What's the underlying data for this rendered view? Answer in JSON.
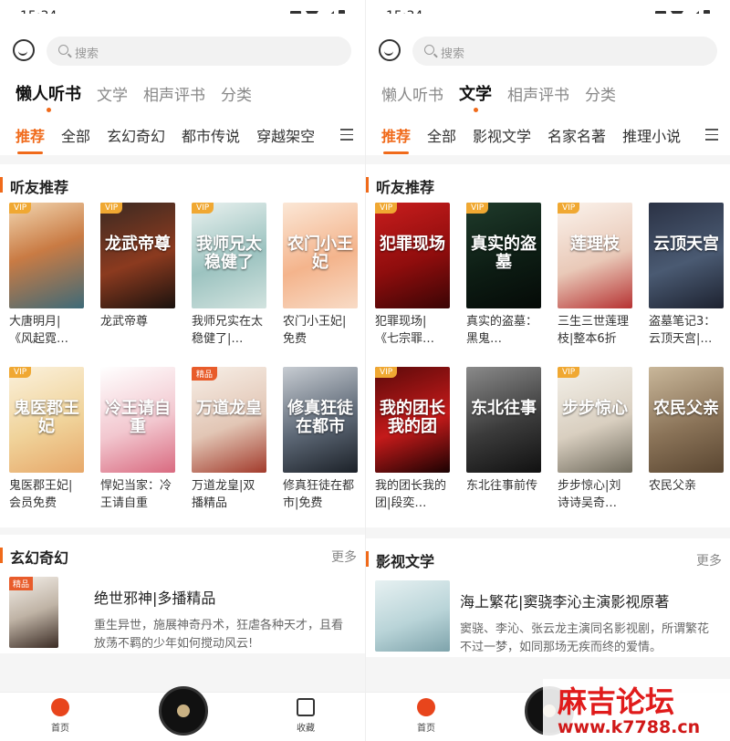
{
  "status": {
    "time": "15:34"
  },
  "colors": {
    "accent": "#f06a1a",
    "vip": "#f0a832"
  },
  "left": {
    "search_placeholder": "搜索",
    "categories": [
      "懒人听书",
      "文学",
      "相声评书",
      "分类"
    ],
    "active_category": 0,
    "subtabs": [
      "推荐",
      "全部",
      "玄幻奇幻",
      "都市传说",
      "穿越架空"
    ],
    "section1": {
      "title": "听友推荐",
      "books": [
        {
          "title": "大唐明月|《风起霓…",
          "badge": "VIP",
          "cover_text": "",
          "bg": "linear-gradient(160deg,#f2d6b0,#c97b44 45%,#3e6a78)"
        },
        {
          "title": "龙武帝尊",
          "badge": "VIP",
          "cover_text": "龙武帝尊",
          "bg": "linear-gradient(160deg,#3b2a22,#8b3a1f 55%,#1a120e)"
        },
        {
          "title": "我师兄实在太稳健了|…",
          "badge": "VIP",
          "cover_text": "我师兄太稳健了",
          "bg": "linear-gradient(160deg,#e9f1ef,#9cc3c0 55%,#d2e3df)"
        },
        {
          "title": "农门小王妃|免费",
          "badge": "",
          "cover_text": "农门小王妃",
          "bg": "linear-gradient(160deg,#fbe7d6,#f4b48c 55%,#f8dbc6)"
        },
        {
          "title": "鬼医郡王妃|会员免费",
          "badge": "VIP",
          "cover_text": "鬼医郡王妃",
          "bg": "linear-gradient(160deg,#fbf1dc,#f0d39a 55%,#e7a86a)"
        },
        {
          "title": "悍妃当家：冷王请自重",
          "badge": "",
          "cover_text": "冷王请自重",
          "bg": "linear-gradient(160deg,#fff,#f2c7cf 55%,#d96a80)"
        },
        {
          "title": "万道龙皇|双播精品",
          "badge": "精品",
          "cover_text": "万道龙皇",
          "bg": "linear-gradient(160deg,#f7efe7,#e2c6b5 55%,#a23a2b)"
        },
        {
          "title": "修真狂徒在都市|免费",
          "badge": "",
          "cover_text": "修真狂徒在都市",
          "bg": "linear-gradient(160deg,#c7ccd2,#5c6775 55%,#1c2128)"
        }
      ]
    },
    "section2": {
      "title": "玄幻奇幻",
      "more": "更多",
      "item": {
        "title": "绝世邪神|多播精品",
        "tag": "精品",
        "desc": "重生异世，施展神奇丹术，狂虐各种天才，且看放荡不羁的少年如何搅动风云!"
      }
    },
    "tabbar": {
      "home": "首页",
      "fav": "收藏"
    }
  },
  "right": {
    "search_placeholder": "搜索",
    "categories": [
      "懒人听书",
      "文学",
      "相声评书",
      "分类"
    ],
    "active_category": 1,
    "subtabs": [
      "推荐",
      "全部",
      "影视文学",
      "名家名著",
      "推理小说"
    ],
    "section1": {
      "title": "听友推荐",
      "books": [
        {
          "title": "犯罪现场|《七宗罪…",
          "badge": "VIP",
          "cover_text": "犯罪现场",
          "bg": "linear-gradient(160deg,#c81d1d,#8f0d0d 55%,#3a0505)"
        },
        {
          "title": "真实的盗墓：黑鬼…",
          "badge": "VIP",
          "cover_text": "真实的盗墓",
          "bg": "linear-gradient(160deg,#1f3b2b,#0d1d14 55%,#050a07)"
        },
        {
          "title": "三生三世莲理枝|整本6折",
          "badge": "VIP",
          "cover_text": "莲理枝",
          "bg": "linear-gradient(160deg,#fbf3ec,#e9c9b8 55%,#b63232)"
        },
        {
          "title": "盗墓笔记3：云顶天宫|…",
          "badge": "",
          "cover_text": "云顶天宫",
          "bg": "linear-gradient(160deg,#2b3245,#4a5a72 55%,#1d2230)"
        },
        {
          "title": "我的团长我的团|段奕…",
          "badge": "VIP",
          "cover_text": "我的团长我的团",
          "bg": "linear-gradient(160deg,#5c0a0a,#c41a1a 55%,#1a0202)"
        },
        {
          "title": "东北往事前传",
          "badge": "",
          "cover_text": "东北往事",
          "bg": "linear-gradient(160deg,#8a8a8a,#3b3b3b 55%,#111)"
        },
        {
          "title": "步步惊心|刘诗诗吴奇…",
          "badge": "VIP",
          "cover_text": "步步惊心",
          "bg": "linear-gradient(160deg,#f4f1ea,#d9cfc0 55%,#6f6a5c)"
        },
        {
          "title": "农民父亲",
          "badge": "",
          "cover_text": "农民父亲",
          "bg": "linear-gradient(160deg,#c9b79a,#8a7358 55%,#5a4631)"
        }
      ]
    },
    "section2": {
      "title": "影视文学",
      "more": "更多",
      "item": {
        "title": "海上繁花|窦骁李沁主演影视原著",
        "tag": "",
        "desc": "窦骁、李沁、张云龙主演同名影视剧，所谓繁花不过一梦，如同那场无疾而终的爱情。"
      }
    },
    "tabbar": {
      "home": "首页"
    }
  },
  "watermark": {
    "line1": "麻吉论坛",
    "line2": "www.k7788.cn"
  }
}
